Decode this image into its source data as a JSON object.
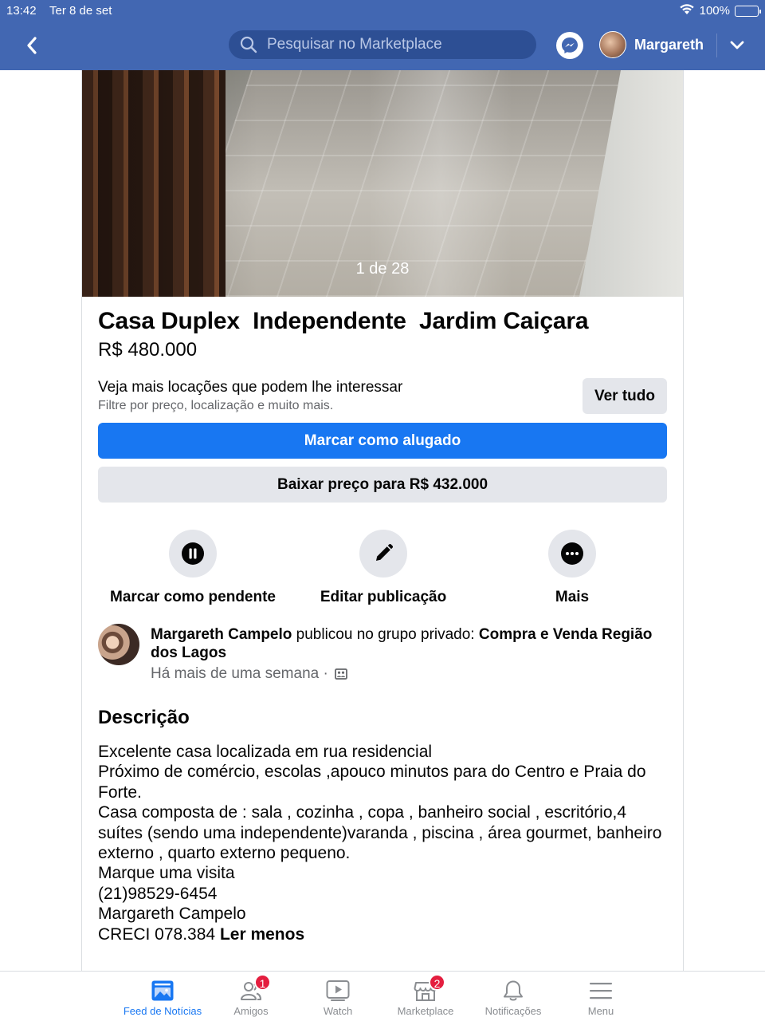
{
  "status_bar": {
    "time": "13:42",
    "date": "Ter 8 de set",
    "battery": "100%",
    "icons": [
      "wifi-icon",
      "battery-icon"
    ]
  },
  "nav": {
    "search_placeholder": "Pesquisar no Marketplace",
    "user_name": "Margareth",
    "icons": [
      "back-icon",
      "search-icon",
      "messenger-icon",
      "chevron-down-icon"
    ]
  },
  "listing": {
    "photo_counter": "1 de 28",
    "title": "Casa Duplex  Independente  Jardim Caiçara",
    "price": "R$ 480.000"
  },
  "promo": {
    "title": "Veja mais locações que podem lhe interessar",
    "subtitle": "Filtre por preço, localização e muito mais.",
    "see_all": "Ver tudo"
  },
  "buttons": {
    "mark_rented": "Marcar como alugado",
    "lower_price": "Baixar preço para R$ 432.000"
  },
  "actions": [
    {
      "label": "Marcar como pendente",
      "icon": "pause-icon"
    },
    {
      "label": "Editar publicação",
      "icon": "pencil-icon"
    },
    {
      "label": "Mais",
      "icon": "more-icon"
    }
  ],
  "poster": {
    "name": "Margareth Campelo",
    "action_text": " publicou no grupo privado: ",
    "group": "Compra e Venda Região dos Lagos",
    "time": "Há mais de uma semana ·",
    "privacy_icon": "group-icon"
  },
  "description": {
    "heading": "Descrição",
    "lines": [
      "Excelente casa localizada em rua residencial",
      "Próximo de comércio, escolas ,apouco  minutos para do Centro e Praia do Forte.",
      "Casa composta de : sala , cozinha , copa , banheiro social , escritório,4 suítes (sendo uma independente)varanda , piscina , área gourmet, banheiro externo , quarto externo pequeno.",
      "Marque uma visita",
      "(21)98529-6454",
      "Margareth Campelo",
      "CRECI 078.384"
    ],
    "read_less": "Ler menos"
  },
  "tabbar": {
    "tabs": [
      {
        "label": "Feed de Notícias",
        "icon": "news-feed-icon",
        "active": true
      },
      {
        "label": "Amigos",
        "icon": "friends-icon",
        "badge": "1"
      },
      {
        "label": "Watch",
        "icon": "watch-icon"
      },
      {
        "label": "Marketplace",
        "icon": "marketplace-icon",
        "badge": "2"
      },
      {
        "label": "Notificações",
        "icon": "bell-icon"
      },
      {
        "label": "Menu",
        "icon": "menu-icon"
      }
    ]
  },
  "colors": {
    "header_blue": "#4267b2",
    "primary_blue": "#1877f2",
    "badge_red": "#e41e3f",
    "button_gray": "#e4e6eb"
  }
}
